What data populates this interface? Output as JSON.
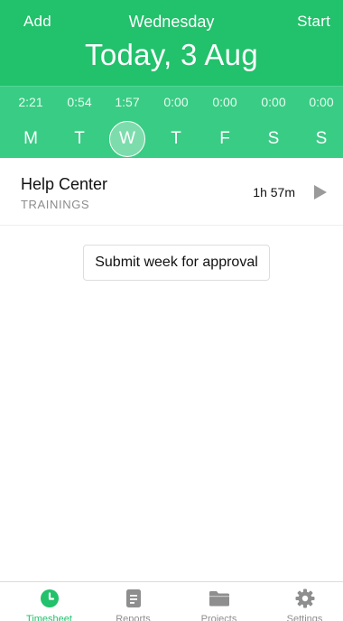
{
  "header": {
    "add_label": "Add",
    "day_name": "Wednesday",
    "start_label": "Start",
    "date_title": "Today, 3 Aug"
  },
  "week": {
    "days": [
      {
        "letter": "M",
        "duration": "2:21",
        "selected": false
      },
      {
        "letter": "T",
        "duration": "0:54",
        "selected": false
      },
      {
        "letter": "W",
        "duration": "1:57",
        "selected": true
      },
      {
        "letter": "T",
        "duration": "0:00",
        "selected": false
      },
      {
        "letter": "F",
        "duration": "0:00",
        "selected": false
      },
      {
        "letter": "S",
        "duration": "0:00",
        "selected": false
      },
      {
        "letter": "S",
        "duration": "0:00",
        "selected": false
      }
    ]
  },
  "entry": {
    "project": "Help Center",
    "task": "TRAININGS",
    "duration": "1h 57m",
    "play_icon": "play-icon"
  },
  "submit": {
    "label": "Submit week for approval"
  },
  "tabs": [
    {
      "label": "Timesheet",
      "icon": "clock-icon",
      "active": true
    },
    {
      "label": "Reports",
      "icon": "document-icon",
      "active": false
    },
    {
      "label": "Projects",
      "icon": "folder-icon",
      "active": false
    },
    {
      "label": "Settings",
      "icon": "gear-icon",
      "active": false
    }
  ],
  "colors": {
    "brand_green": "#22c16b",
    "week_strip": "#39cc84",
    "inactive_tab": "#8e8e8e"
  }
}
